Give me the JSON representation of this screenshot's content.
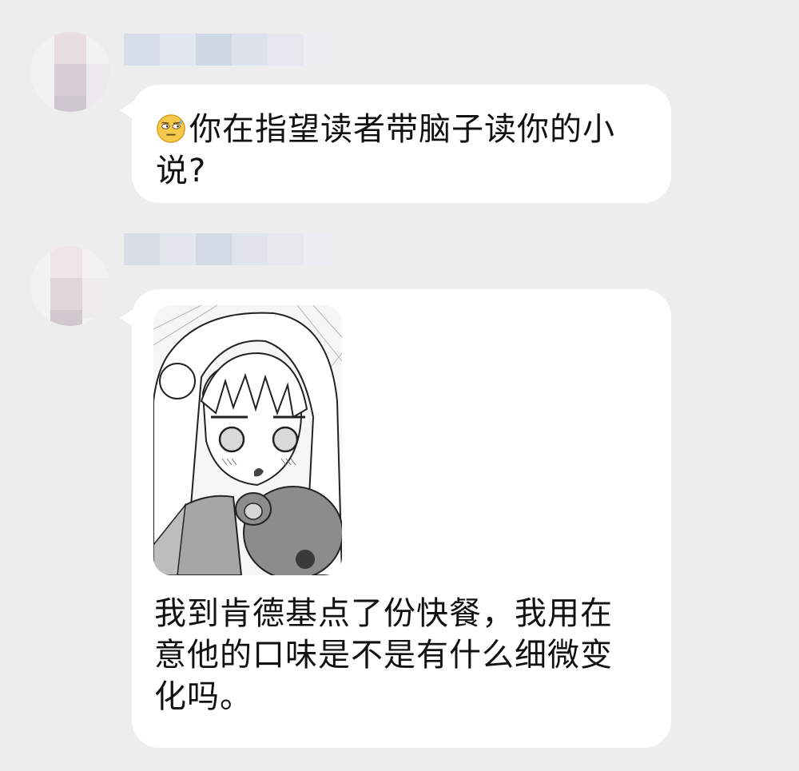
{
  "messages": [
    {
      "sender_name": "",
      "emoji": "speechless-face-emoji",
      "text": "你在指望读者带脑子读你的小说?"
    },
    {
      "sender_name": "",
      "sticker": "anime-girl-holding-teddy-bear-sticker",
      "text": "我到肯德基点了份快餐，我用在意他的口味是不是有什么细微变化吗。"
    }
  ],
  "colors": {
    "background": "#ededed",
    "bubble": "#ffffff",
    "text": "#111111"
  }
}
